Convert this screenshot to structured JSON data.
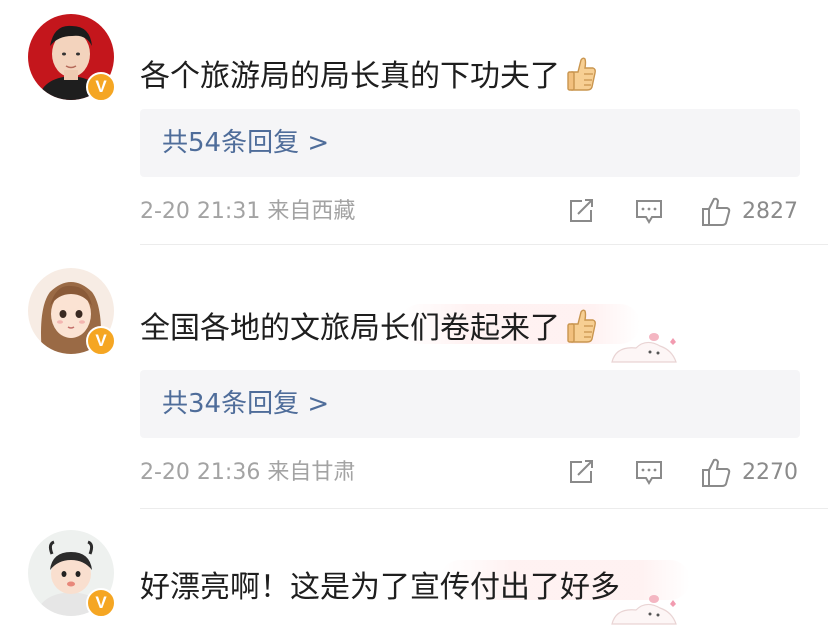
{
  "comments": [
    {
      "text": "各个旅游局的局长真的下功夫了",
      "replies": "共54条回复 >",
      "time": "2-20 21:31 来自西藏",
      "likes": "2827",
      "verified_badge": "V",
      "has_thumb_emoji": true,
      "has_sticker": false
    },
    {
      "text": "全国各地的文旅局长们卷起来了",
      "replies": "共34条回复 >",
      "time": "2-20 21:36 来自甘肃",
      "likes": "2270",
      "verified_badge": "V",
      "has_thumb_emoji": true,
      "has_sticker": true
    },
    {
      "text": "好漂亮啊！这是为了宣传付出了好多",
      "verified_badge": "V",
      "has_thumb_emoji": false,
      "has_sticker": true
    }
  ],
  "icons": {
    "share": "share-icon",
    "comment": "comment-icon",
    "like": "thumbs-up-icon",
    "verified": "verified-v-badge",
    "emoji": "thumbs-up-emoji"
  },
  "colors": {
    "reply_link": "#4f6d9a",
    "meta_text": "#a3a3a3",
    "reply_box_bg": "#f5f5f7",
    "verified_badge": "#f5a623"
  }
}
